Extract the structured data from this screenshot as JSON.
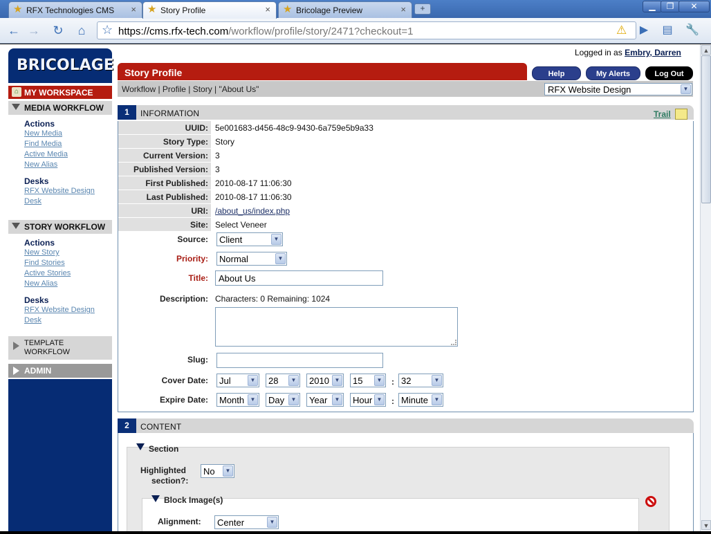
{
  "browser": {
    "tabs": [
      {
        "label": "RFX Technologies CMS",
        "close": "×"
      },
      {
        "label": "Story Profile",
        "close": "×"
      },
      {
        "label": "Bricolage Preview",
        "close": "×"
      }
    ],
    "new_tab": "+",
    "window_controls": {
      "minimize": "▁",
      "maximize": "❐",
      "close": "✕"
    },
    "url_host": "https://cms.rfx-tech.com",
    "url_path": "/workflow/profile/story/2471?checkout=1"
  },
  "logo": {
    "text": "BRICOLAGE"
  },
  "nav": {
    "my_workspace": "MY WORKSPACE",
    "media_workflow": {
      "title": "MEDIA WORKFLOW",
      "actions_title": "Actions",
      "actions": [
        "New Media",
        "Find Media",
        "Active Media",
        "New Alias"
      ],
      "desks_title": "Desks",
      "desks": [
        "RFX Website Design",
        "Desk"
      ]
    },
    "story_workflow": {
      "title": "STORY WORKFLOW",
      "actions_title": "Actions",
      "actions": [
        "New Story",
        "Find Stories",
        "Active Stories",
        "New Alias"
      ],
      "desks_title": "Desks",
      "desks": [
        "RFX Website Design",
        "Desk"
      ]
    },
    "template_workflow": [
      "TEMPLATE",
      "WORKFLOW"
    ],
    "admin": "ADMIN"
  },
  "header": {
    "logged_in_prefix": "Logged in as",
    "user": "Embry, Darren",
    "page_title": "Story Profile",
    "help": "Help",
    "my_alerts": "My Alerts",
    "log_out": "Log Out",
    "breadcrumb": "Workflow | Profile | Story | \"About Us\"",
    "site_select": "RFX Website Design"
  },
  "information": {
    "number": "1",
    "title": "INFORMATION",
    "trail": "Trail",
    "fields": [
      {
        "label": "UUID:",
        "value": "5e001683-d456-48c9-9430-6a759e5b9a33"
      },
      {
        "label": "Story Type:",
        "value": "Story"
      },
      {
        "label": "Current Version:",
        "value": "3"
      },
      {
        "label": "Published Version:",
        "value": "3"
      },
      {
        "label": "First Published:",
        "value": "2010-08-17 11:06:30"
      },
      {
        "label": "Last Published:",
        "value": "2010-08-17 11:06:30"
      },
      {
        "label": "URI:",
        "value": "/about_us/index.php"
      },
      {
        "label": "Site:",
        "value": "Select Veneer"
      }
    ],
    "source_label": "Source:",
    "source_value": "Client",
    "priority_label": "Priority:",
    "priority_value": "Normal",
    "title_label": "Title:",
    "title_value": "About Us",
    "description_label": "Description:",
    "description_counter": "Characters: 0 Remaining: 1024",
    "slug_label": "Slug:",
    "slug_value": "",
    "cover_date_label": "Cover Date:",
    "cover_date": {
      "month": "Jul",
      "day": "28",
      "year": "2010",
      "hour": "15",
      "minute": "32"
    },
    "expire_date_label": "Expire Date:",
    "expire_date": {
      "month": "Month",
      "day": "Day",
      "year": "Year",
      "hour": "Hour",
      "minute": "Minute"
    },
    "time_separator": ":"
  },
  "content": {
    "number": "2",
    "title": "CONTENT",
    "section_title": "Section",
    "highlighted_label_1": "Highlighted",
    "highlighted_label_2": "section?:",
    "highlighted_value": "No",
    "block_title": "Block Image(s)",
    "alignment_label": "Alignment:",
    "alignment_value": "Center"
  },
  "colors": {
    "brand_navy": "#062c74",
    "brand_red": "#b51c10",
    "required_label": "#a81d14"
  }
}
